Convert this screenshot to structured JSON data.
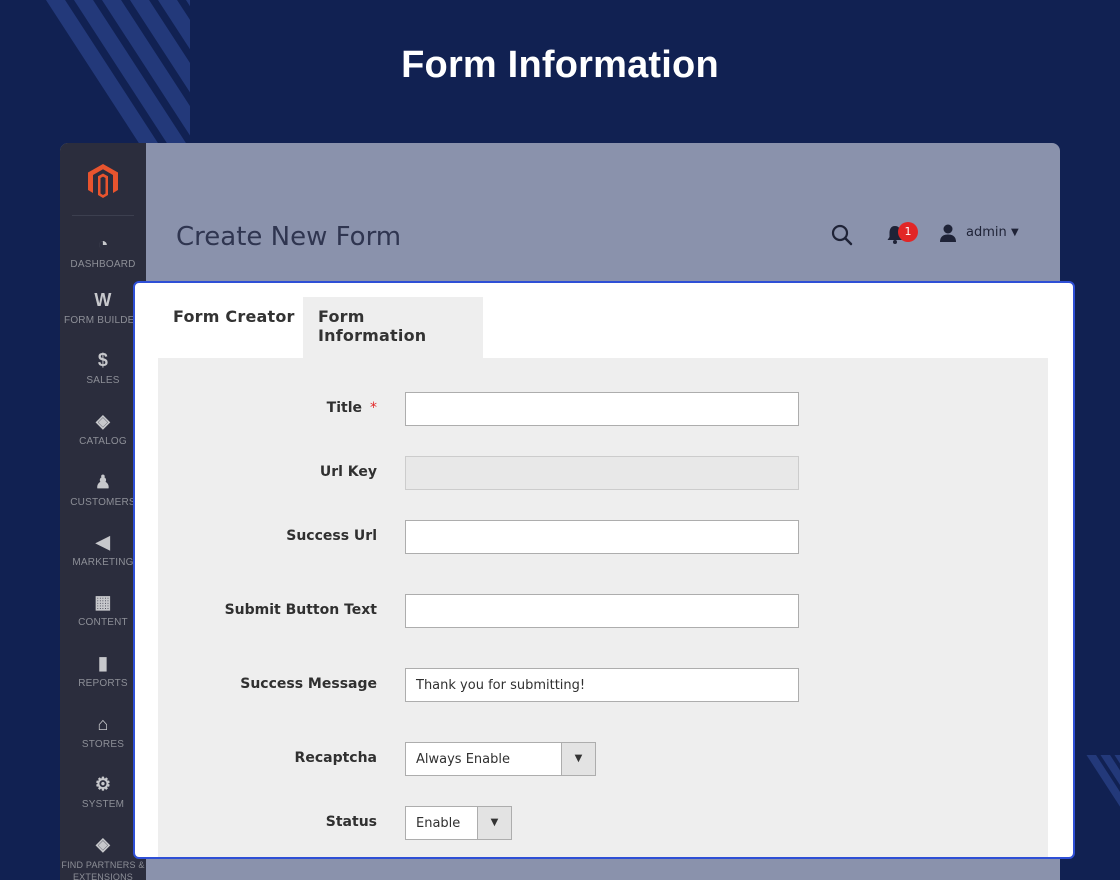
{
  "banner": {
    "title": "Form Information"
  },
  "sidebar": {
    "items": [
      {
        "label": "DASHBOARD",
        "icon": "gauge-icon"
      },
      {
        "label": "FORM BUILDER",
        "icon": "form-builder-icon"
      },
      {
        "label": "SALES",
        "icon": "dollar-icon"
      },
      {
        "label": "CATALOG",
        "icon": "box-icon"
      },
      {
        "label": "CUSTOMERS",
        "icon": "person-icon"
      },
      {
        "label": "MARKETING",
        "icon": "megaphone-icon"
      },
      {
        "label": "CONTENT",
        "icon": "content-icon"
      },
      {
        "label": "REPORTS",
        "icon": "bar-chart-icon"
      },
      {
        "label": "STORES",
        "icon": "store-icon"
      },
      {
        "label": "SYSTEM",
        "icon": "gear-icon"
      },
      {
        "label": "FIND PARTNERS & EXTENSIONS",
        "icon": "cubes-icon"
      }
    ]
  },
  "header": {
    "page_title": "Create New Form",
    "notification_count": "1",
    "user": "admin"
  },
  "tabs": [
    {
      "label": "Form Creator",
      "active": false
    },
    {
      "label": "Form Information",
      "active": true
    }
  ],
  "form": {
    "title": {
      "label": "Title",
      "value": "",
      "required": true
    },
    "url_key": {
      "label": "Url Key",
      "value": ""
    },
    "success_url": {
      "label": "Success Url",
      "value": ""
    },
    "submit_button_text": {
      "label": "Submit Button Text",
      "value": ""
    },
    "success_message": {
      "label": "Success Message",
      "value": "Thank you for submitting!"
    },
    "recaptcha": {
      "label": "Recaptcha",
      "value": "Always Enable"
    },
    "status": {
      "label": "Status",
      "value": "Enable"
    }
  },
  "colors": {
    "background": "#112152",
    "highlight_border": "#2e4fd6",
    "sidebar": "#2b2d3d",
    "logo": "#e8542e",
    "badge": "#e22626"
  }
}
